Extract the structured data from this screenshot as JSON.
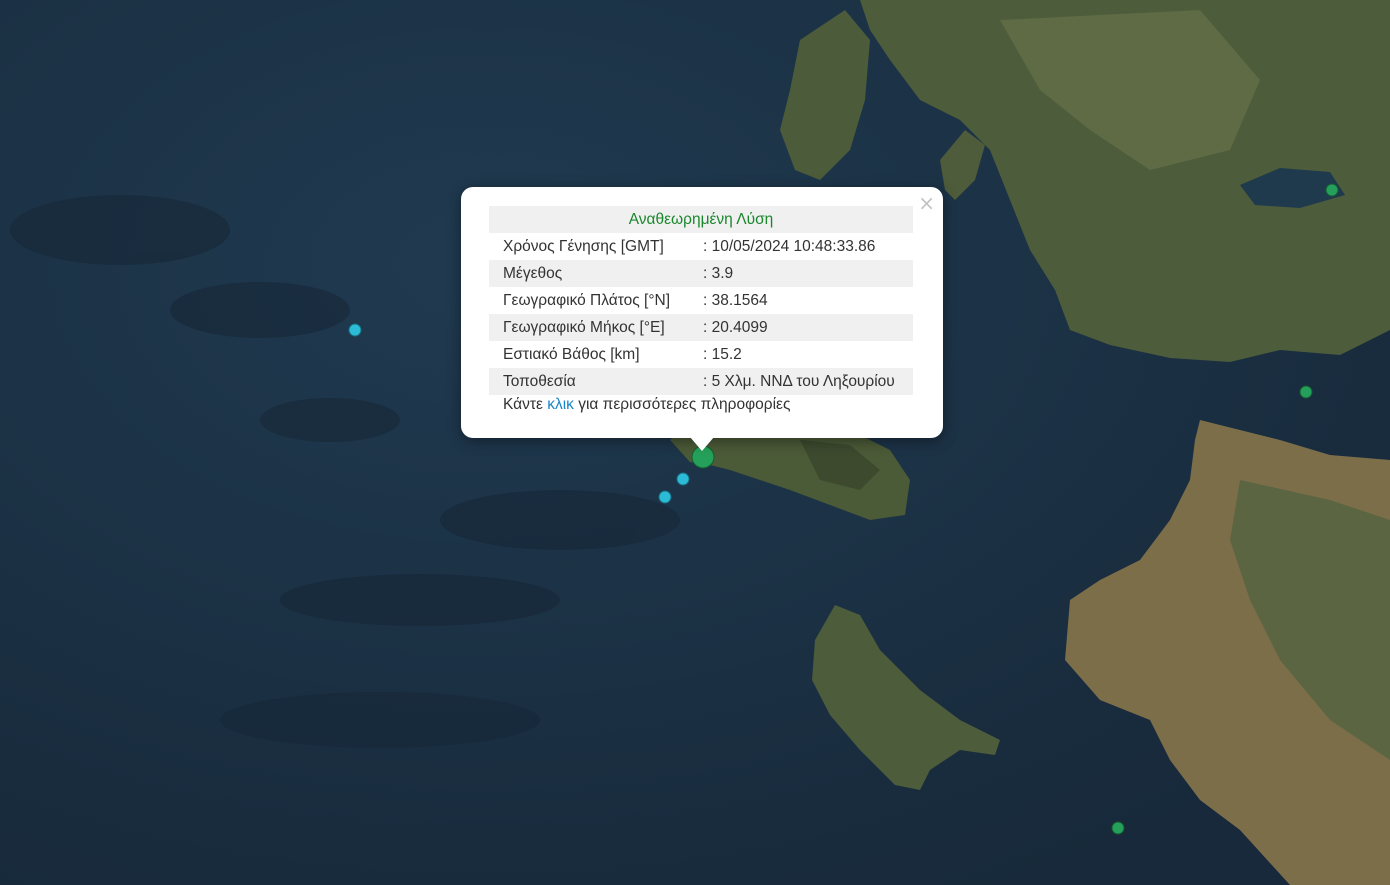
{
  "map": {
    "colors": {
      "sea": "#1d3549",
      "land": "#4b5a37",
      "event_cyan": "#2bbbd6",
      "event_green": "#25a05a"
    },
    "events": [
      {
        "lat": 38.1564,
        "lon": 20.4099,
        "color": "green",
        "selected": true
      },
      {
        "color": "cyan"
      },
      {
        "color": "cyan"
      },
      {
        "color": "cyan"
      },
      {
        "color": "green"
      },
      {
        "color": "green"
      },
      {
        "color": "green"
      }
    ]
  },
  "popup": {
    "close_symbol": "×",
    "title": "Αναθεωρημένη Λύση",
    "rows": [
      {
        "label": "Χρόνος Γένησης [GMT]",
        "value": ": 10/05/2024 10:48:33.86"
      },
      {
        "label": "Μέγεθος",
        "value": ": 3.9"
      },
      {
        "label": "Γεωγραφικό Πλάτος [°N]",
        "value": ": 38.1564"
      },
      {
        "label": "Γεωγραφικό Μήκος [°E]",
        "value": ": 20.4099"
      },
      {
        "label": "Εστιακό Βάθος [km]",
        "value": ": 15.2"
      },
      {
        "label": "Τοποθεσία",
        "value": ": 5 Χλμ. ΝΝΔ του Ληξουρίου"
      }
    ],
    "more_prefix": "Κάντε ",
    "more_link": "κλικ",
    "more_suffix": " για περισσότερες πληροφορίες"
  }
}
